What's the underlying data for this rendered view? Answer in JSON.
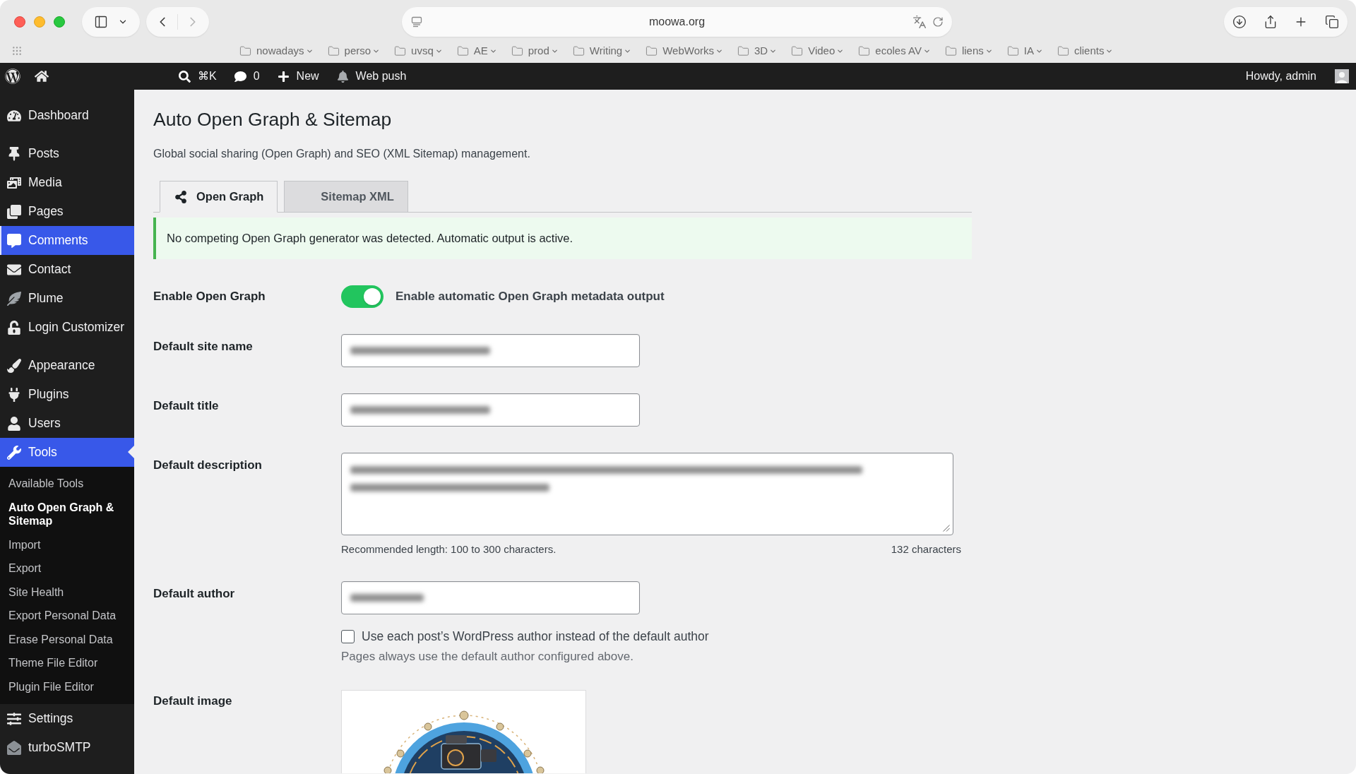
{
  "browser": {
    "url": "moowa.org",
    "nav": [
      {
        "kind": "back",
        "disabled": false
      },
      {
        "kind": "forward",
        "disabled": true
      }
    ],
    "bookmarks": [
      {
        "label": "nowadays"
      },
      {
        "label": "perso"
      },
      {
        "label": "uvsq"
      },
      {
        "label": "AE"
      },
      {
        "label": "prod"
      },
      {
        "label": "Writing"
      },
      {
        "label": "WebWorks"
      },
      {
        "label": "3D"
      },
      {
        "label": "Video"
      },
      {
        "label": "ecoles AV"
      },
      {
        "label": "liens"
      },
      {
        "label": "IA"
      },
      {
        "label": "clients"
      }
    ]
  },
  "admin_bar": {
    "items": [
      {
        "kind": "search",
        "label": "⌘K"
      },
      {
        "kind": "comments",
        "label": "0"
      },
      {
        "kind": "new",
        "label": "New"
      },
      {
        "kind": "notifications",
        "label": "Web push"
      }
    ],
    "greeting": "Howdy, admin"
  },
  "sidebar": {
    "groups": [
      {
        "items": [
          {
            "kind": "dashboard",
            "label": "Dashboard",
            "selected": false,
            "hovered": false
          }
        ]
      },
      {
        "items": [
          {
            "kind": "posts",
            "label": "Posts",
            "selected": false,
            "hovered": false
          },
          {
            "kind": "media",
            "label": "Media",
            "selected": false,
            "hovered": false
          },
          {
            "kind": "pages",
            "label": "Pages",
            "selected": false,
            "hovered": false
          },
          {
            "kind": "comments",
            "label": "Comments",
            "selected": false,
            "hovered": true
          },
          {
            "kind": "contact",
            "label": "Contact",
            "selected": false,
            "hovered": false
          },
          {
            "kind": "plume",
            "label": "Plume",
            "selected": false,
            "hovered": false
          },
          {
            "kind": "login_customizer",
            "label": "Login Customizer",
            "selected": false,
            "hovered": false
          }
        ]
      },
      {
        "items": [
          {
            "kind": "appearance",
            "label": "Appearance",
            "selected": false,
            "hovered": false
          },
          {
            "kind": "plugins",
            "label": "Plugins",
            "selected": false,
            "hovered": false
          },
          {
            "kind": "users",
            "label": "Users",
            "selected": false,
            "hovered": false
          },
          {
            "kind": "tools",
            "label": "Tools",
            "selected": true,
            "hovered": false,
            "children": [
              {
                "label": "Available Tools",
                "selected": false
              },
              {
                "label": "Auto Open Graph & Sitemap",
                "selected": true
              },
              {
                "label": "Import",
                "selected": false
              },
              {
                "label": "Export",
                "selected": false
              },
              {
                "label": "Site Health",
                "selected": false
              },
              {
                "label": "Export Personal Data",
                "selected": false
              },
              {
                "label": "Erase Personal Data",
                "selected": false
              },
              {
                "label": "Theme File Editor",
                "selected": false
              },
              {
                "label": "Plugin File Editor",
                "selected": false
              }
            ]
          },
          {
            "kind": "settings",
            "label": "Settings",
            "selected": false,
            "hovered": false
          },
          {
            "kind": "smtp",
            "label": "turboSMTP",
            "selected": false,
            "hovered": false
          }
        ]
      }
    ]
  },
  "page": {
    "title": "Auto Open Graph & Sitemap",
    "description": "Global social sharing (Open Graph) and SEO (XML Sitemap) management.",
    "tabs": [
      {
        "kind": "share",
        "label": "Open Graph",
        "selected": true
      },
      {
        "kind": "plain",
        "label": "Sitemap XML",
        "selected": false
      }
    ],
    "notice": {
      "success": true,
      "text": "No competing Open Graph generator was detected. Automatic output is active."
    },
    "fields": [
      {
        "kind": "toggle",
        "label": "Enable Open Graph",
        "on": true,
        "caption": "Enable automatic Open Graph metadata output"
      },
      {
        "kind": "text",
        "label": "Default site name",
        "value_blurred": true
      },
      {
        "kind": "text",
        "label": "Default title",
        "value_blurred": true
      },
      {
        "kind": "textarea",
        "label": "Default description",
        "value_blurred": true,
        "hint": "Recommended length: 100 to 300 characters.",
        "counter": "132 characters"
      },
      {
        "kind": "text",
        "label": "Default author",
        "value_blurred": true,
        "checkbox": {
          "label": "Use each post’s WordPress author instead of the default author",
          "checked": false
        },
        "note": "Pages always use the default author configured above."
      },
      {
        "kind": "image",
        "label": "Default image"
      }
    ]
  }
}
